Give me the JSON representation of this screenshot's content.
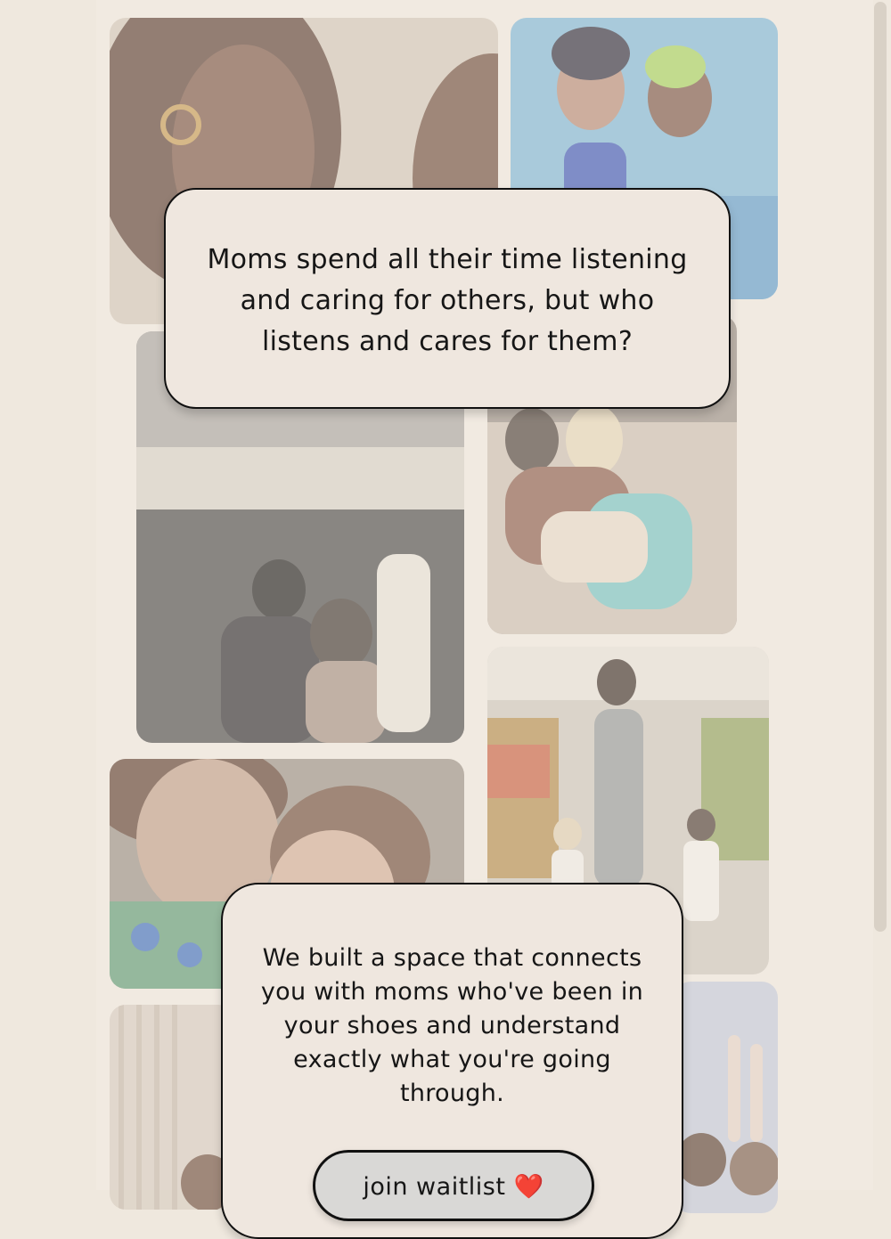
{
  "hero_card": {
    "text": "Moms spend all their time listening and caring for others, but who listens and cares for them?"
  },
  "cta_card": {
    "text": "We built a space that connects you with moms who've been in your shoes and understand exactly what you're going through.",
    "button_label": "join waitlist",
    "button_icon": "❤️"
  },
  "photos": [
    {
      "name": "photo-mother-child-faces",
      "palette": [
        "#cbb6a3",
        "#6f5142"
      ]
    },
    {
      "name": "photo-swimming-pool",
      "palette": [
        "#8fc0dc",
        "#3d6fa8"
      ]
    },
    {
      "name": "photo-museum-sculptures",
      "palette": [
        "#8d8a86",
        "#3c3a39"
      ]
    },
    {
      "name": "photo-sofa-hug",
      "palette": [
        "#b9aa9d",
        "#6f6359"
      ]
    },
    {
      "name": "photo-market-family",
      "palette": [
        "#c9c2b8",
        "#837b72"
      ]
    },
    {
      "name": "photo-smiling-mom-baby",
      "palette": [
        "#b8a898",
        "#5b7d7a"
      ]
    },
    {
      "name": "photo-bottom-left",
      "palette": [
        "#d4c9bd",
        "#8b7c6d"
      ]
    },
    {
      "name": "photo-bottom-right",
      "palette": [
        "#bfc6d6",
        "#7d8199"
      ]
    }
  ]
}
